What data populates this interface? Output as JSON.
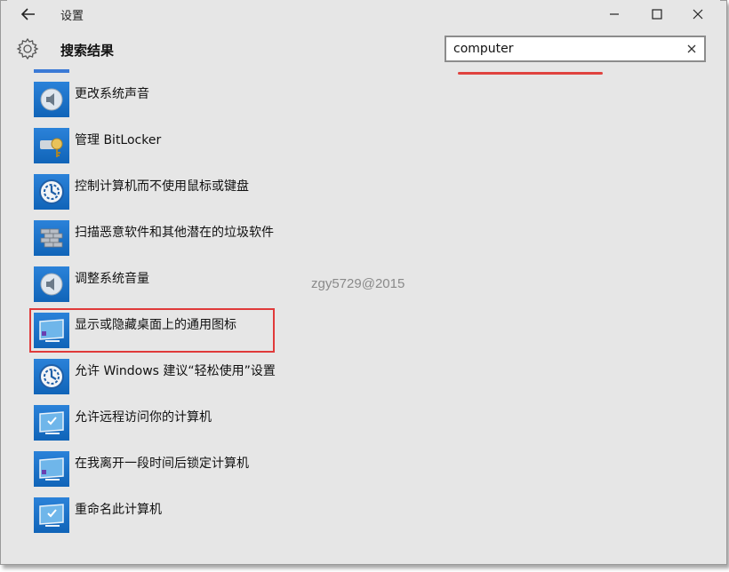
{
  "titlebar": {
    "title": "设置",
    "back_icon": "arrow-left-icon",
    "minimize_icon": "minimize-icon",
    "maximize_icon": "maximize-icon",
    "close_icon": "close-icon"
  },
  "header": {
    "title": "搜索结果",
    "settings_icon": "gear-icon"
  },
  "search": {
    "value": "computer",
    "placeholder": "",
    "clear_icon": "close-icon"
  },
  "results": [
    {
      "label": "更改系统声音",
      "icon": "speaker-icon"
    },
    {
      "label": "管理 BitLocker",
      "icon": "bitlocker-key-icon"
    },
    {
      "label": "控制计算机而不使用鼠标或键盘",
      "icon": "ease-of-access-icon"
    },
    {
      "label": "扫描恶意软件和其他潜在的垃圾软件",
      "icon": "firewall-wall-icon"
    },
    {
      "label": "调整系统音量",
      "icon": "speaker-icon"
    },
    {
      "label": "显示或隐藏桌面上的通用图标",
      "icon": "monitor-icon"
    },
    {
      "label": "允许 Windows 建议“轻松使用”设置",
      "icon": "ease-of-access-icon"
    },
    {
      "label": "允许远程访问你的计算机",
      "icon": "monitor-check-icon"
    },
    {
      "label": "在我离开一段时间后锁定计算机",
      "icon": "monitor-icon"
    },
    {
      "label": "重命名此计算机",
      "icon": "monitor-check-icon"
    }
  ],
  "watermark": "zgy5729@2015",
  "colors": {
    "accent": "#1a73c9",
    "highlight": "#e03a3a",
    "background": "#e6e6e6"
  }
}
